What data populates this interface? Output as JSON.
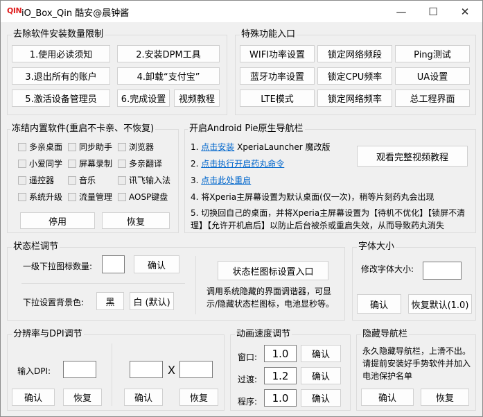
{
  "window": {
    "icon_text": "QIN",
    "title": "iO_Box_Qin   酷安@晨钟酱",
    "minimize_glyph": "—",
    "maximize_glyph": "☐",
    "close_glyph": "✕"
  },
  "install_limit": {
    "title": "去除软件安装数量限制",
    "btn_read_notice": "1.使用必读须知",
    "btn_install_dpm": "2.安装DPM工具",
    "btn_logout": "3.退出所有的账户",
    "btn_uninstall_alipay": "4.卸载“支付宝”",
    "btn_activate_admin": "5.激活设备管理员",
    "btn_done": "6.完成设置",
    "btn_video": "视频教程"
  },
  "special": {
    "title": "特殊功能入口",
    "btn_wifi_power": "WIFI功率设置",
    "btn_lock_band": "锁定网络频段",
    "btn_ping": "Ping测试",
    "btn_bt_power": "蓝牙功率设置",
    "btn_lock_cpu": "锁定CPU频率",
    "btn_ua": "UA设置",
    "btn_lte": "LTE模式",
    "btn_lock_freq": "锁定网络频率",
    "btn_engineer": "总工程界面"
  },
  "freeze": {
    "title": "冻结内置软件(重启不卡亲、不恢复)",
    "items": [
      "多亲桌面",
      "同步助手",
      "浏览器",
      "小爱同学",
      "屏幕录制",
      "多亲翻译",
      "遥控器",
      "音乐",
      "讯飞输入法",
      "系统升级",
      "流量管理",
      "AOSP键盘"
    ],
    "btn_apply": "停用",
    "btn_restore": "恢复"
  },
  "android_pie": {
    "title": "开启Android Pie原生导航栏",
    "step1_prefix": "1. ",
    "step1_link": "点击安装",
    "step1_suffix": " XperiaLauncher 魔改版",
    "step2_prefix": "2. ",
    "step2_link": "点击执行开启药丸命令",
    "step3_prefix": "3. ",
    "step3_link": "点击此处重启",
    "step4": "4. 将Xperia主屏幕设置为默认桌面(仅一次)，稍等片刻药丸会出现",
    "step5_line1": "5. 切换回自己的桌面，并将Xperia主屏幕设置为【待机不优化】【锁屏不清",
    "step5_line2": "理】【允许开机启后】以防止后台被杀或重启失效，从而导致药丸消失",
    "btn_full_video": "观看完整视频教程"
  },
  "statusbar": {
    "title": "状态栏调节",
    "icon_count_label": "一级下拉图标数量:",
    "icon_count_value": "",
    "btn_confirm": "确认",
    "bg_color_label": "下拉设置背景色:",
    "btn_black": "黑",
    "btn_white": "白 (默认)",
    "btn_icon_entry": "状态栏图标设置入口",
    "desc_line1": "调用系统隐藏的界面调谐器，可显",
    "desc_line2": "示/隐藏状态栏图标，电池显秒等。"
  },
  "fontsize": {
    "title": "字体大小",
    "label": "修改字体大小:",
    "value": "",
    "btn_confirm": "确认",
    "btn_restore": "恢复默认(1.0)"
  },
  "dpi": {
    "title": "分辨率与DPI调节",
    "dpi_label": "输入DPI:",
    "dpi_value": "",
    "btn_dpi_confirm": "确认",
    "btn_dpi_restore": "恢复",
    "width_value": "",
    "x_label": "X",
    "height_value": "",
    "btn_res_confirm": "确认",
    "btn_res_restore": "恢复"
  },
  "animation": {
    "title": "动画速度调节",
    "window_label": "窗口:",
    "window_value": "1.0",
    "transition_label": "过渡:",
    "transition_value": "1.2",
    "program_label": "程序:",
    "program_value": "1.0",
    "btn_confirm": "确认"
  },
  "hide_nav": {
    "title": "隐藏导航栏",
    "desc_line1": "永久隐藏导航栏，上滑不出。",
    "desc_line2": "请提前安装好手势软件并加入",
    "desc_line3": "电池保护名单",
    "btn_confirm": "确认",
    "btn_restore": "恢复"
  }
}
